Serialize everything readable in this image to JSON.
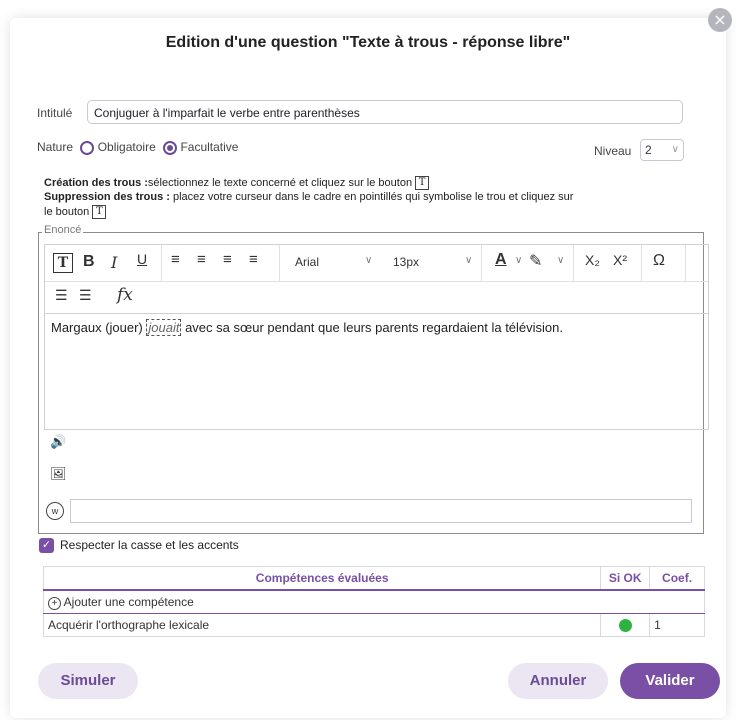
{
  "dialog": {
    "title": "Edition d'une question \"Texte à trous - réponse libre\"",
    "close_icon": "×"
  },
  "intitule": {
    "label": "Intitulé",
    "value": "Conjuguer à l'imparfait le verbe entre parenthèses"
  },
  "nature": {
    "label": "Nature",
    "options": [
      "Obligatoire",
      "Facultative"
    ],
    "selected": "Facultative"
  },
  "niveau": {
    "label": "Niveau",
    "value": "2"
  },
  "instructions": {
    "creation_bold": "Création des trous :",
    "creation_text": "sélectionnez le texte concerné et cliquez sur le bouton",
    "suppression_bold": "Suppression des trous :",
    "suppression_text": "placez votre curseur dans le cadre en pointillés qui symbolise le trou et cliquez sur",
    "suppression_text2": "le bouton"
  },
  "enonce": {
    "legend": "Enoncé",
    "toolbar": {
      "font": "Arial",
      "size": "13px"
    },
    "text_before": "Margaux (jouer) ",
    "gap": "jouait",
    "text_after": " avec sa sœur pendant que leurs parents regardaient la télévision."
  },
  "options": {
    "respect_case_label": "Respecter la casse et les accents",
    "respect_case_checked": true
  },
  "competences": {
    "headers": [
      "Compétences évaluées",
      "Si OK",
      "Coef."
    ],
    "add_label": "Ajouter une compétence",
    "rows": [
      {
        "name": "Acquérir l'orthographe lexicale",
        "status": "ok",
        "coef": "1"
      }
    ]
  },
  "footer": {
    "simulate_label": "Simuler",
    "cancel_label": "Annuler",
    "validate_label": "Valider"
  },
  "colors": {
    "accent": "#7a4fa6",
    "success": "#2fb340"
  }
}
